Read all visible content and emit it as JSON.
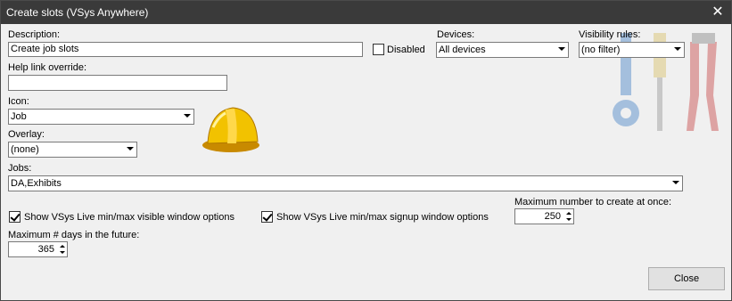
{
  "window": {
    "title": "Create slots (VSys Anywhere)"
  },
  "description": {
    "label": "Description:",
    "value": "Create job slots"
  },
  "disabled": {
    "label": "Disabled",
    "checked": false
  },
  "devices": {
    "label": "Devices:",
    "value": "All devices"
  },
  "visibility_rules": {
    "label": "Visibility rules:",
    "value": "(no filter)"
  },
  "help_link": {
    "label": "Help link override:",
    "value": ""
  },
  "icon": {
    "label": "Icon:",
    "value": "Job"
  },
  "overlay": {
    "label": "Overlay:",
    "value": "(none)"
  },
  "jobs": {
    "label": "Jobs:",
    "value": "DA,Exhibits"
  },
  "option_visible": {
    "label": "Show VSys Live min/max visible window options",
    "checked": true
  },
  "option_signup": {
    "label": "Show VSys Live min/max signup window options",
    "checked": true
  },
  "max_create": {
    "label": "Maximum number to create at once:",
    "value": "250"
  },
  "max_days": {
    "label": "Maximum # days in the future:",
    "value": "365"
  },
  "buttons": {
    "close": "Close"
  },
  "icons": [
    "hard-hat-icon",
    "tools-watermark-icon",
    "close-icon",
    "chevron-down-icon",
    "spinner-icon"
  ]
}
